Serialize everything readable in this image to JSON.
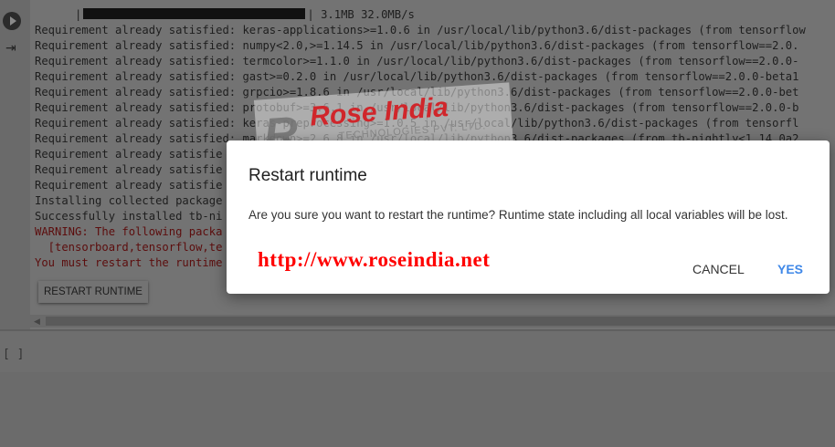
{
  "output": {
    "progress_text": "3.1MB 32.0MB/s",
    "lines": [
      "Requirement already satisfied: keras-applications>=1.0.6 in /usr/local/lib/python3.6/dist-packages (from tensorflow",
      "Requirement already satisfied: numpy<2.0,>=1.14.5 in /usr/local/lib/python3.6/dist-packages (from tensorflow==2.0.",
      "Requirement already satisfied: termcolor>=1.1.0 in /usr/local/lib/python3.6/dist-packages (from tensorflow==2.0.0-",
      "Requirement already satisfied: gast>=0.2.0 in /usr/local/lib/python3.6/dist-packages (from tensorflow==2.0.0-beta1",
      "Requirement already satisfied: grpcio>=1.8.6 in /usr/local/lib/python3.6/dist-packages (from tensorflow==2.0.0-bet",
      "Requirement already satisfied: protobuf>=3.6.1 in /usr/local/lib/python3.6/dist-packages (from tensorflow==2.0.0-b",
      "Requirement already satisfied: keras-preprocessing>=1.0.5 in /usr/local/lib/python3.6/dist-packages (from tensorfl",
      "Requirement already satisfied: markdown>=2.6.8 in /usr/local/lib/python3.6/dist-packages (from tb-nightly<1.14.0a2",
      "Requirement already satisfie",
      "Requirement already satisfie",
      "Requirement already satisfie",
      "Installing collected package",
      "Successfully installed tb-ni"
    ],
    "warning_lines": [
      "WARNING: The following packa",
      "  [tensorboard,tensorflow,te",
      "You must restart the runtime"
    ],
    "restart_button": "RESTART RUNTIME"
  },
  "next_cell": {
    "bracket": "[ ]"
  },
  "watermark": {
    "brand": "Rose India",
    "sub": "TECHNOLOGIES PVT. LTD."
  },
  "dialog": {
    "title": "Restart runtime",
    "message": "Are you sure you want to restart the runtime? Runtime state including all local variables will be lost.",
    "url": "http://www.roseindia.net",
    "cancel": "CANCEL",
    "yes": "YES",
    "accent_color": "#3f88e8"
  }
}
